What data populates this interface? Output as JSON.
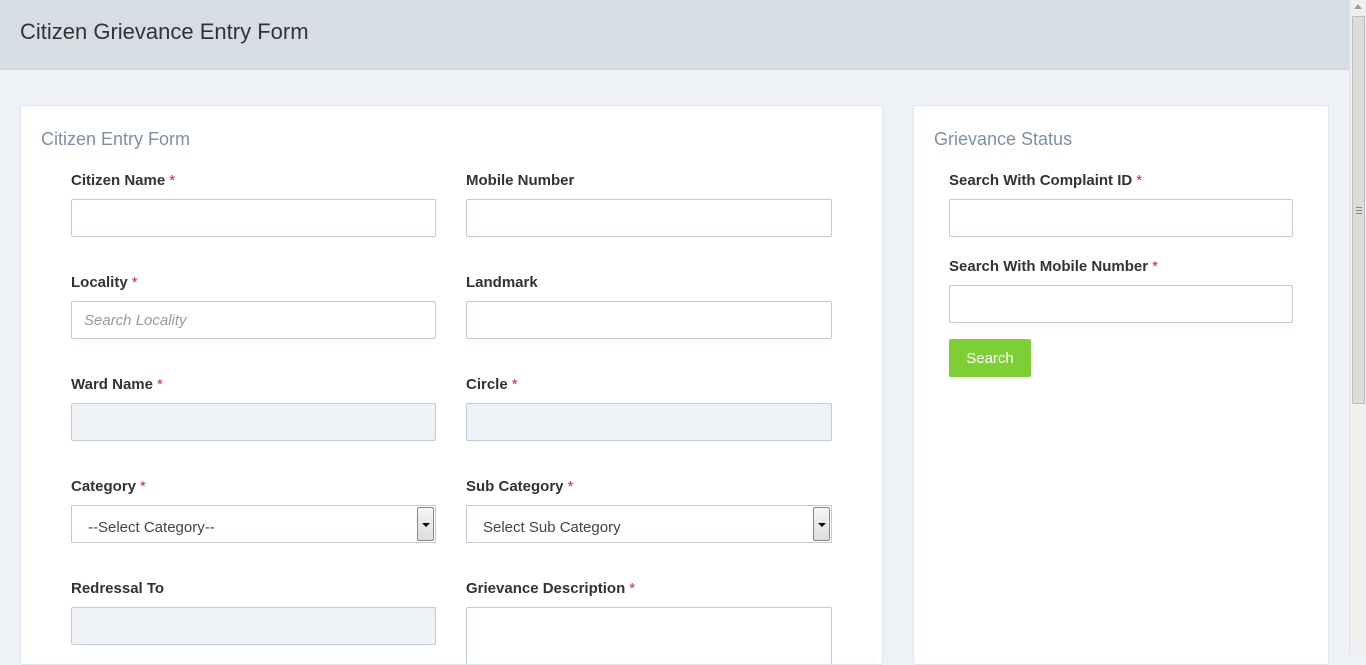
{
  "header": {
    "title": "Citizen Grievance Entry Form"
  },
  "entry_form": {
    "title": "Citizen Entry Form",
    "citizen_name": {
      "label": "Citizen Name",
      "required": "*",
      "value": ""
    },
    "mobile_number": {
      "label": "Mobile Number",
      "value": ""
    },
    "locality": {
      "label": "Locality",
      "required": "*",
      "placeholder": "Search Locality"
    },
    "landmark": {
      "label": "Landmark",
      "value": ""
    },
    "ward_name": {
      "label": "Ward Name",
      "required": "*"
    },
    "circle": {
      "label": "Circle",
      "required": "*"
    },
    "category": {
      "label": "Category",
      "required": "*",
      "selected": "--Select Category--"
    },
    "sub_category": {
      "label": "Sub Category",
      "required": "*",
      "selected": "Select Sub Category"
    },
    "redressal_to": {
      "label": "Redressal To"
    },
    "grievance_description": {
      "label": "Grievance Description",
      "required": "*"
    }
  },
  "status_form": {
    "title": "Grievance Status",
    "complaint_id": {
      "label": "Search With Complaint ID",
      "required": "*"
    },
    "mobile_number": {
      "label": "Search With Mobile Number",
      "required": "*"
    },
    "search_label": "Search"
  },
  "colors": {
    "accent_green": "#7ece36",
    "required_red": "#e02222",
    "header_bg": "#d7dde5"
  }
}
